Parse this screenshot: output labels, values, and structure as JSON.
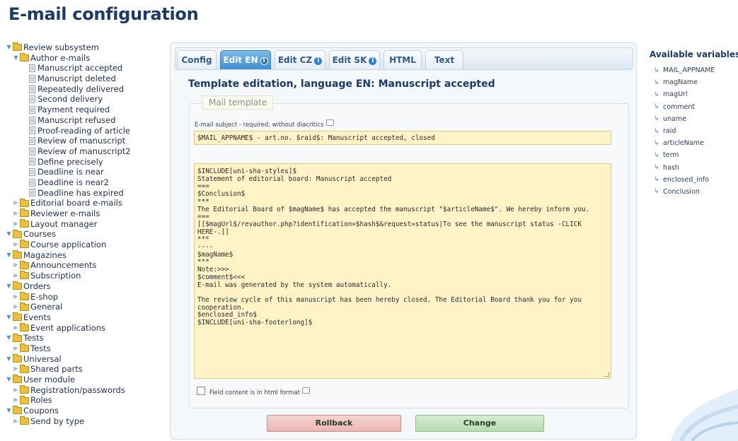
{
  "page": {
    "title": "E-mail configuration"
  },
  "tree": [
    {
      "label": "Review subsystem",
      "level": 0,
      "type": "folder",
      "expanded": true
    },
    {
      "label": "Author e-mails",
      "level": 1,
      "type": "folder",
      "expanded": true
    },
    {
      "label": "Manuscript accepted",
      "level": 2,
      "type": "item"
    },
    {
      "label": "Manuscript deleted",
      "level": 2,
      "type": "item"
    },
    {
      "label": "Repeatedly delivered",
      "level": 2,
      "type": "item"
    },
    {
      "label": "Second delivery",
      "level": 2,
      "type": "item"
    },
    {
      "label": "Payment required",
      "level": 2,
      "type": "item"
    },
    {
      "label": "Manuscript refused",
      "level": 2,
      "type": "item"
    },
    {
      "label": "Proof-reading of article",
      "level": 2,
      "type": "item"
    },
    {
      "label": "Review of manuscript",
      "level": 2,
      "type": "item"
    },
    {
      "label": "Review of manuscript2",
      "level": 2,
      "type": "item"
    },
    {
      "label": "Define precisely",
      "level": 2,
      "type": "item"
    },
    {
      "label": "Deadline is near",
      "level": 2,
      "type": "item"
    },
    {
      "label": "Deadline is near2",
      "level": 2,
      "type": "item"
    },
    {
      "label": "Deadline has expired",
      "level": 2,
      "type": "item"
    },
    {
      "label": "Editorial board e-mails",
      "level": 1,
      "type": "folder",
      "expanded": false
    },
    {
      "label": "Reviewer e-mails",
      "level": 1,
      "type": "folder",
      "expanded": false
    },
    {
      "label": "Layout manager",
      "level": 1,
      "type": "folder",
      "expanded": false
    },
    {
      "label": "Courses",
      "level": 0,
      "type": "folder",
      "expanded": true
    },
    {
      "label": "Course application",
      "level": 1,
      "type": "folder",
      "expanded": false
    },
    {
      "label": "Magazines",
      "level": 0,
      "type": "folder",
      "expanded": true
    },
    {
      "label": "Announcements",
      "level": 1,
      "type": "folder",
      "expanded": false
    },
    {
      "label": "Subscription",
      "level": 1,
      "type": "folder",
      "expanded": false
    },
    {
      "label": "Orders",
      "level": 0,
      "type": "folder",
      "expanded": true
    },
    {
      "label": "E-shop",
      "level": 1,
      "type": "folder",
      "expanded": false
    },
    {
      "label": "General",
      "level": 1,
      "type": "folder",
      "expanded": false
    },
    {
      "label": "Events",
      "level": 0,
      "type": "folder",
      "expanded": true
    },
    {
      "label": "Event applications",
      "level": 1,
      "type": "folder",
      "expanded": false
    },
    {
      "label": "Tests",
      "level": 0,
      "type": "folder",
      "expanded": true
    },
    {
      "label": "Tests",
      "level": 1,
      "type": "folder",
      "expanded": false
    },
    {
      "label": "Universal",
      "level": 0,
      "type": "folder",
      "expanded": true
    },
    {
      "label": "Shared parts",
      "level": 1,
      "type": "folder",
      "expanded": false
    },
    {
      "label": "User module",
      "level": 0,
      "type": "folder",
      "expanded": true
    },
    {
      "label": "Registration/passwords",
      "level": 1,
      "type": "folder",
      "expanded": false
    },
    {
      "label": "Roles",
      "level": 1,
      "type": "folder",
      "expanded": false
    },
    {
      "label": "Coupons",
      "level": 0,
      "type": "folder",
      "expanded": true
    },
    {
      "label": "Send by type",
      "level": 1,
      "type": "folder",
      "expanded": false
    }
  ],
  "tabs": [
    {
      "label": "Config",
      "active": false,
      "info": false
    },
    {
      "label": "Edit EN",
      "active": true,
      "info": true
    },
    {
      "label": "Edit CZ",
      "active": false,
      "info": true
    },
    {
      "label": "Edit SK",
      "active": false,
      "info": true
    },
    {
      "label": "HTML",
      "active": false,
      "info": false
    },
    {
      "label": "Text",
      "active": false,
      "info": false
    }
  ],
  "editor": {
    "heading": "Template editation, language EN: Manuscript accepted",
    "legend": "Mail template",
    "subject_label": "E-mail subject - required, without diacritics",
    "subject_value": "$MAIL_APPNAME$ - art.no. $raid$: Manuscript accepted, closed",
    "body_value": "$INCLUDE[uni-sha-styles]$\nStatement of editorial board: Manuscript accepted\n===\n$Conclusion$\n***\nThe Editorial Board of $magName$ has accepted the manuscript \"$articleName$\". We hereby inform you.\n===\n[[$magUrl$/revauthor.php?identification=$hash$&request=status|To see the manuscript status -CLICK\nHERE-.]]\n***\n----\n$magName$\n***\nNote:>>>\n$comment$<<<\nE-mail was generated by the system automatically.\n\nThe review cycle of this manuscript has been hereby closed. The Editorial Board thank you for you\ncooperation.\n$enclosed_info$\n$INCLUDE[uni-sha-footerlong]$",
    "html_checkbox_label": "Field content is in html format",
    "html_checkbox_checked": false,
    "rollback_label": "Rollback",
    "change_label": "Change"
  },
  "variables": {
    "title": "Available variables",
    "items": [
      "MAIL_APPNAME",
      "magName",
      "magUrl",
      "comment",
      "uname",
      "raid",
      "articleName",
      "term",
      "hash",
      "enclosed_info",
      "Conclusion"
    ]
  },
  "colors": {
    "title": "#1c3a66",
    "active_tab": "#3f8fd1",
    "field_background": "#fff3c7",
    "rollback": "#ecb7b3",
    "change": "#b6dcb0"
  }
}
